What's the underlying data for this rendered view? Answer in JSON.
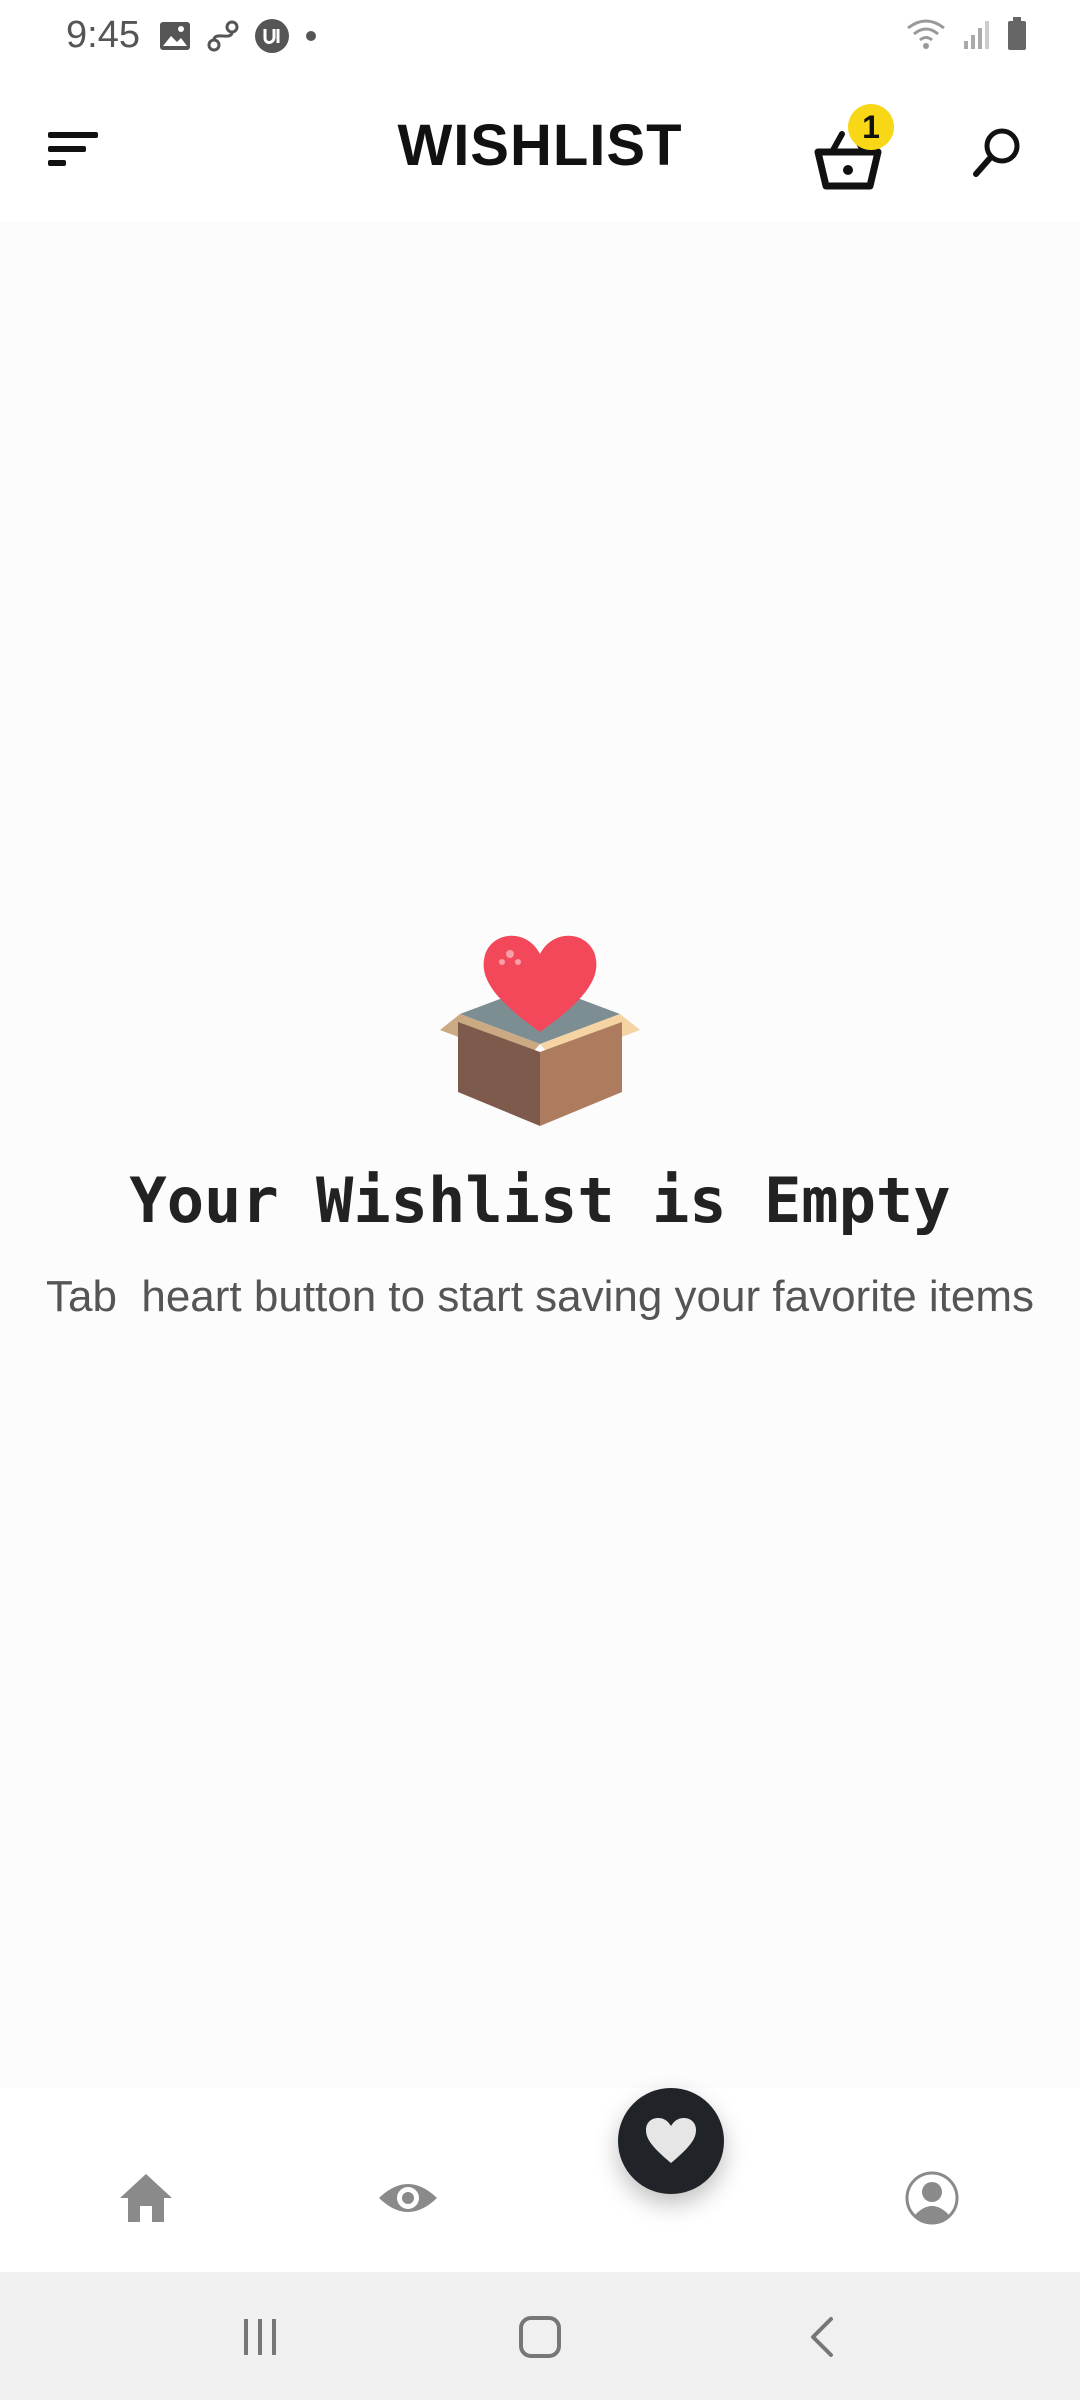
{
  "status_bar": {
    "time": "9:45",
    "left_icons": [
      "gallery-icon",
      "link-icon",
      "app-u-icon",
      "dot-icon"
    ],
    "right_icons": [
      "wifi-icon",
      "signal-icon",
      "battery-icon"
    ]
  },
  "header": {
    "title": "WISHLIST",
    "cart_count": "1",
    "menu_icon": "menu-icon",
    "cart_icon": "basket-icon",
    "search_icon": "search-icon",
    "badge_color": "#f7d716"
  },
  "empty_state": {
    "illustration": "heart-box-icon",
    "title": "Your Wishlist is Empty",
    "subtitle": "Tab  heart button to start saving your favorite items"
  },
  "bottom_nav": {
    "items": [
      {
        "icon": "home-icon"
      },
      {
        "icon": "eye-icon"
      },
      {
        "icon": "heart-icon",
        "active": true
      },
      {
        "icon": "profile-icon"
      }
    ],
    "active_color": "#202428",
    "inactive_color": "#8a8a8a"
  },
  "system_nav": {
    "buttons": [
      "recents-icon",
      "home-button-icon",
      "back-icon"
    ]
  }
}
